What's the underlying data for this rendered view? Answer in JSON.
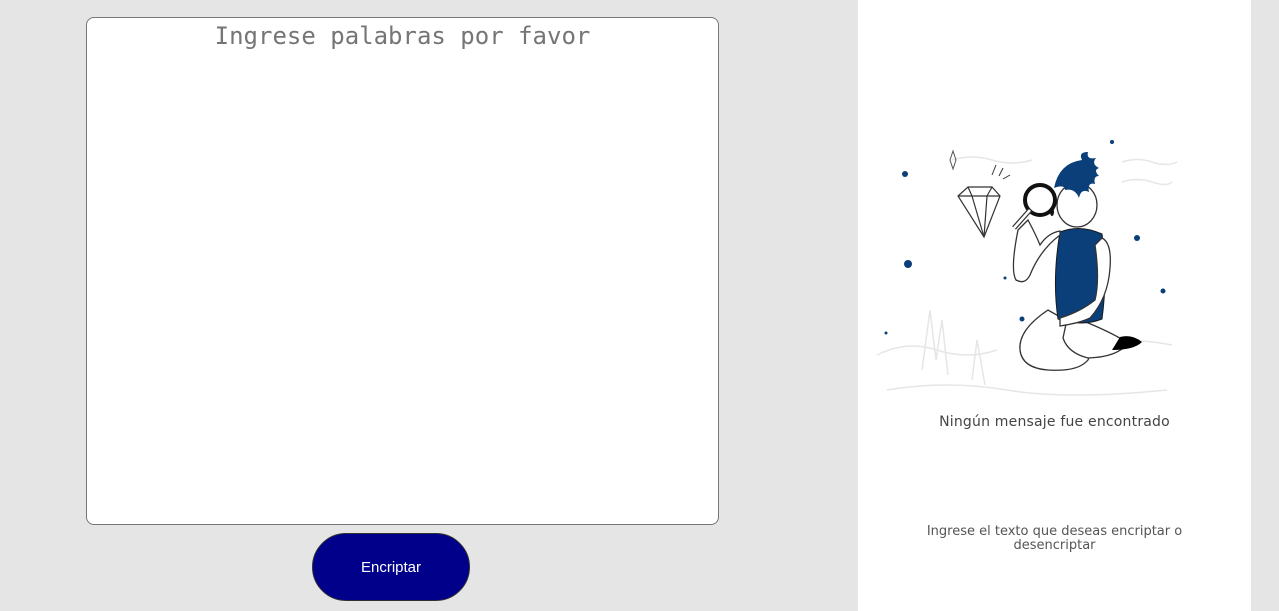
{
  "input": {
    "placeholder": "Ingrese palabras por favor",
    "value": ""
  },
  "buttons": {
    "encrypt_label": "Encriptar"
  },
  "output": {
    "illustration_icon": "person-magnifying-glass-diamond-illustration",
    "no_message_text": "Ningún mensaje fue encontrado",
    "instructions_text": "Ingrese el texto que deseas encriptar o desencriptar"
  },
  "colors": {
    "background": "#e5e5e5",
    "panel": "#ffffff",
    "button": "#00008b",
    "accent": "#0b3f7a"
  }
}
